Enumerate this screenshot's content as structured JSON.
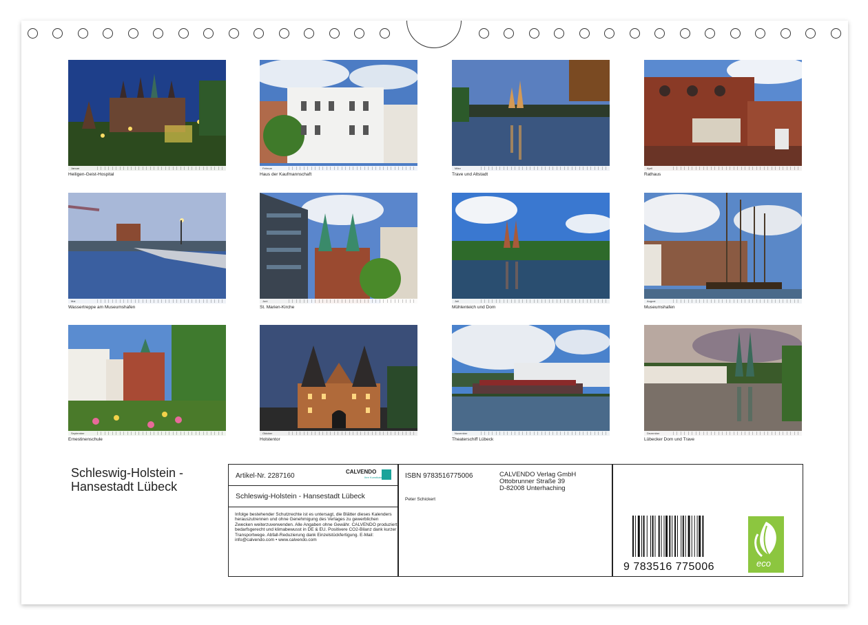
{
  "months": [
    {
      "label": "Januar",
      "caption": "Heiligen-Geist-Hospital"
    },
    {
      "label": "Februar",
      "caption": "Haus der Kaufmannschaft"
    },
    {
      "label": "März",
      "caption": "Trave und Altstadt"
    },
    {
      "label": "April",
      "caption": "Rathaus"
    },
    {
      "label": "Mai",
      "caption": "Wassertreppe am Museumshafen"
    },
    {
      "label": "Juni",
      "caption": "St. Marien-Kirche"
    },
    {
      "label": "Juli",
      "caption": "Mühlenteich und Dom"
    },
    {
      "label": "August",
      "caption": "Museumshafen"
    },
    {
      "label": "September",
      "caption": "Ernestinenschule"
    },
    {
      "label": "Oktober",
      "caption": "Holstentor"
    },
    {
      "label": "November",
      "caption": "Theaterschiff Lübeck"
    },
    {
      "label": "Dezember",
      "caption": "Lübecker Dom und Trave"
    }
  ],
  "title_line1": "Schleswig-Holstein -",
  "title_line2": "Hansestadt Lübeck",
  "info": {
    "article": "Artikel-Nr. 2287160",
    "logo_name": "CALVENDO",
    "logo_tag": "Ihre Kunstkalender",
    "subtitle": "Schleswig-Holstein - Hansestadt Lübeck",
    "legal": "Infolge bestehender Schutzrechte ist es untersagt, die Blätter dieses Kalenders herauszutrennen und ohne Genehmigung des Verlages zu gewerblichen Zwecken weiterzuverwenden. Alle Angaben ohne Gewähr. CALVENDO produziert bedarfsgerecht und klimabewusst in DE & EU. Positivere CO2-Bilanz dank kurzer Transportwege. Abfall-Reduzierung dank Einzelstückfertigung. E-Mail: info@calvendo.com • www.calvendo.com",
    "isbn": "ISBN 9783516775006",
    "publisher": "CALVENDO Verlag GmbH",
    "street": "Ottobrunner Straße 39",
    "city": "D-82008 Unterhaching",
    "author": "Peter Schickert",
    "ean": "9 783516 775006",
    "eco_label": "eco"
  },
  "colors": {
    "eco_green": "#8cc63f",
    "calvendo_teal": "#1aa39a"
  }
}
